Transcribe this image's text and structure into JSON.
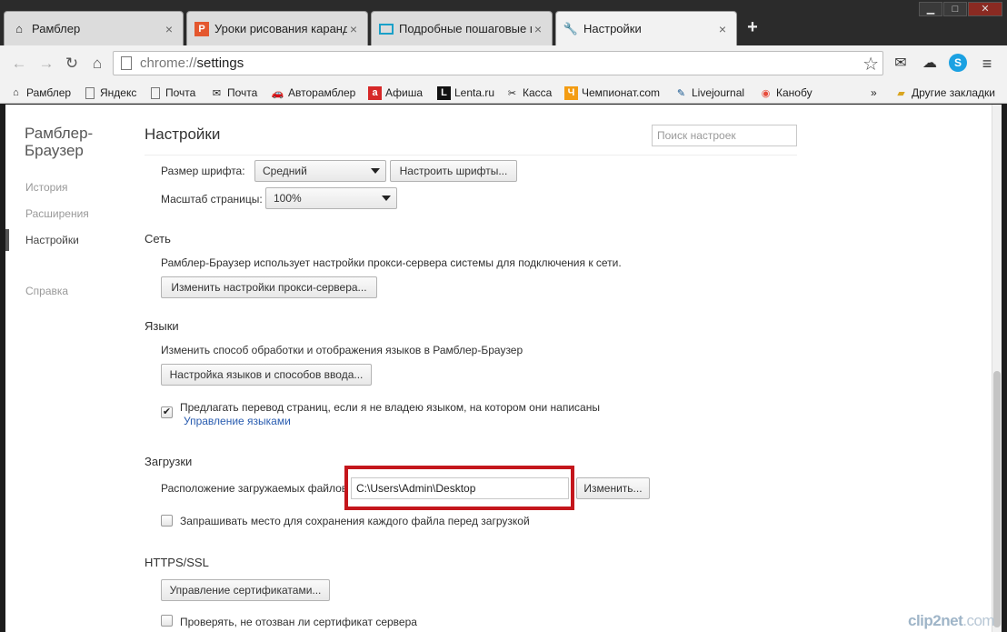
{
  "window_controls": [
    "▁",
    "□",
    "✕"
  ],
  "tabs": [
    {
      "title": "Рамблер",
      "icon": "rambler-home-icon",
      "active": false
    },
    {
      "title": "Уроки рисования каранд",
      "icon": "p-letter-icon",
      "active": false
    },
    {
      "title": "Подробные пошаговые и",
      "icon": "monitor-icon",
      "active": false
    },
    {
      "title": "Настройки",
      "icon": "wrench-icon",
      "active": true
    }
  ],
  "toolbar": {
    "url_scheme": "chrome://",
    "url_path": "settings"
  },
  "bookmarks": [
    {
      "label": "Рамблер",
      "icon": "rambler-home-icon"
    },
    {
      "label": "Яндекс",
      "icon": "page-icon"
    },
    {
      "label": "Почта",
      "icon": "page-icon"
    },
    {
      "label": "Почта",
      "icon": "mail-icon"
    },
    {
      "label": "Авторамблер",
      "icon": "car-icon"
    },
    {
      "label": "Афиша",
      "icon": "afisha-icon"
    },
    {
      "label": "Lenta.ru",
      "icon": "lenta-icon"
    },
    {
      "label": "Касса",
      "icon": "tickets-icon"
    },
    {
      "label": "Чемпионат.com",
      "icon": "championat-icon"
    },
    {
      "label": "Livejournal",
      "icon": "livejournal-icon"
    },
    {
      "label": "Канобу",
      "icon": "kanobu-icon"
    }
  ],
  "bookmarks_overflow": "»",
  "other_bookmarks": "Другие закладки",
  "sidebar": {
    "title": "Рамблер-Браузер",
    "items": [
      "История",
      "Расширения",
      "Настройки",
      "Справка"
    ]
  },
  "settings": {
    "title": "Настройки",
    "search_placeholder": "Поиск настроек",
    "font_size_label": "Размер шрифта:",
    "font_size_value": "Средний",
    "font_settings_button": "Настроить шрифты...",
    "page_zoom_label": "Масштаб страницы:",
    "page_zoom_value": "100%",
    "network": {
      "heading": "Сеть",
      "description": "Рамблер-Браузер использует настройки прокси-сервера системы для подключения к сети.",
      "button": "Изменить настройки прокси-сервера..."
    },
    "languages": {
      "heading": "Языки",
      "description": "Изменить способ обработки и отображения языков в Рамблер-Браузер",
      "button": "Настройка языков и способов ввода...",
      "translate_label": "Предлагать перевод страниц, если я не владею языком, на котором они написаны",
      "translate_checked": true,
      "manage_link": "Управление языками"
    },
    "downloads": {
      "heading": "Загрузки",
      "location_label": "Расположение загружаемых файлов",
      "location_value": "C:\\Users\\Admin\\Desktop",
      "change_button": "Изменить...",
      "ask_label": "Запрашивать место для сохранения каждого файла перед загрузкой",
      "ask_checked": false
    },
    "https": {
      "heading": "HTTPS/SSL",
      "certs_button": "Управление сертификатами...",
      "revocation_label": "Проверять, не отозван ли сертификат сервера",
      "revocation_checked": false
    }
  },
  "watermark": {
    "brand": "clip2net",
    "domain": ".com"
  },
  "colors": {
    "highlight": "#c4161c",
    "link": "#2a5db0",
    "tab_strip": "#2b2b2b"
  }
}
